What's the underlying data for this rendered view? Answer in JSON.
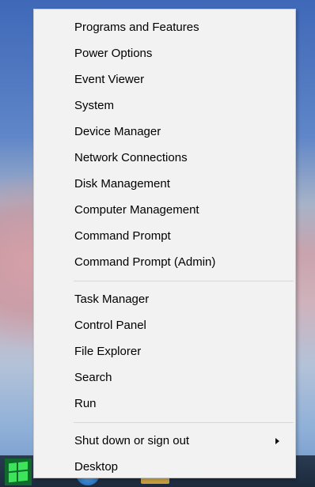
{
  "context_menu": {
    "groups": [
      {
        "items": [
          {
            "label": "Programs and Features"
          },
          {
            "label": "Power Options"
          },
          {
            "label": "Event Viewer"
          },
          {
            "label": "System"
          },
          {
            "label": "Device Manager"
          },
          {
            "label": "Network Connections"
          },
          {
            "label": "Disk Management"
          },
          {
            "label": "Computer Management"
          },
          {
            "label": "Command Prompt"
          },
          {
            "label": "Command Prompt (Admin)"
          }
        ]
      },
      {
        "items": [
          {
            "label": "Task Manager"
          },
          {
            "label": "Control Panel"
          },
          {
            "label": "File Explorer"
          },
          {
            "label": "Search"
          },
          {
            "label": "Run"
          }
        ]
      },
      {
        "items": [
          {
            "label": "Shut down or sign out",
            "submenu_icon": "chevron-right-icon"
          },
          {
            "label": "Desktop"
          }
        ]
      }
    ]
  },
  "taskbar": {
    "start_icon": "windows-logo-icon",
    "pinned_icons": [
      "internet-explorer-icon",
      "file-explorer-icon"
    ]
  }
}
